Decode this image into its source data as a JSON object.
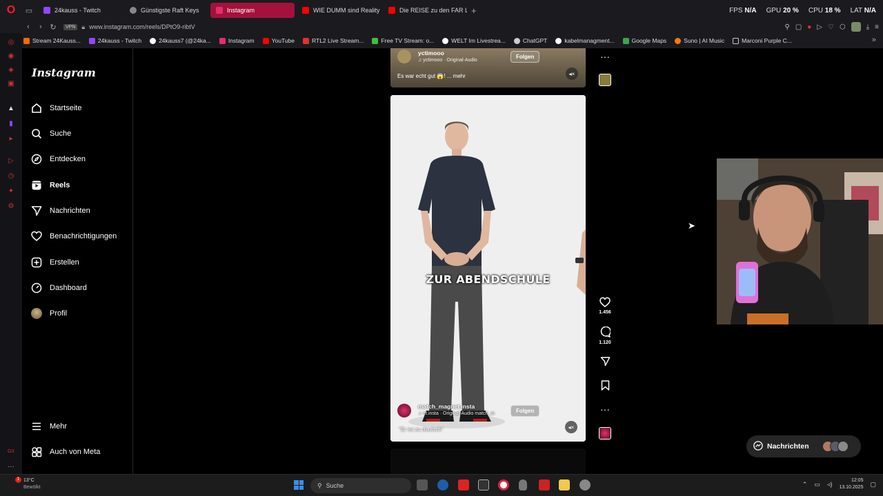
{
  "browser": {
    "tabs": [
      {
        "label": "24kauss - Twitch",
        "icon": "twitch-icon",
        "color": "#9146ff"
      },
      {
        "label": "Günstigste Raft Keys",
        "icon": "globe-icon",
        "color": "#888888"
      },
      {
        "label": "Instagram",
        "icon": "instagram-icon",
        "color": "#e1306c",
        "active": true
      },
      {
        "label": "WIE DUMM sind Reality S",
        "icon": "youtube-icon",
        "color": "#ff0000"
      },
      {
        "label": "Die REISE zu den FAR LA",
        "icon": "youtube-icon",
        "color": "#ff0000"
      }
    ],
    "stats": {
      "fps_label": "FPS",
      "fps_value": "N/A",
      "gpu_label": "GPU",
      "gpu_value": "20 %",
      "cpu_label": "CPU",
      "cpu_value": "18 %",
      "lat_label": "LAT",
      "lat_value": "N/A"
    },
    "vpn_label": "VPN",
    "url": "www.instagram.com/reels/DPtO9-ribtV",
    "bookmarks": [
      {
        "label": "Stream 24Kauss...",
        "color": "#ff6a00"
      },
      {
        "label": "24kauss - Twitch",
        "color": "#9146ff"
      },
      {
        "label": "24kauss7 (@24ka...",
        "color": "#ffffff"
      },
      {
        "label": "Instagram",
        "color": "#e1306c"
      },
      {
        "label": "YouTube",
        "color": "#ff0000"
      },
      {
        "label": "RTL2 Live Stream...",
        "color": "#e5312b"
      },
      {
        "label": "Free TV Stream: o...",
        "color": "#3fbf3f"
      },
      {
        "label": "WELT Im Livestrea...",
        "color": "#ffffff"
      },
      {
        "label": "ChatGPT",
        "color": "#cccccc"
      },
      {
        "label": "kabelmanagment...",
        "color": "#ffffff"
      },
      {
        "label": "Google Maps",
        "color": "#34a853"
      },
      {
        "label": "Suno | AI Music",
        "color": "#ff7a00"
      },
      {
        "label": "Marconi Purple C...",
        "color": "#cccccc"
      }
    ]
  },
  "instagram": {
    "logo": "Instagram",
    "nav": [
      {
        "label": "Startseite",
        "icon": "home-icon"
      },
      {
        "label": "Suche",
        "icon": "search-icon"
      },
      {
        "label": "Entdecken",
        "icon": "compass-icon"
      },
      {
        "label": "Reels",
        "icon": "reels-icon",
        "active": true
      },
      {
        "label": "Nachrichten",
        "icon": "send-icon"
      },
      {
        "label": "Benachrichtigungen",
        "icon": "heart-icon"
      },
      {
        "label": "Erstellen",
        "icon": "plus-square-icon"
      },
      {
        "label": "Dashboard",
        "icon": "dashboard-icon"
      },
      {
        "label": "Profil",
        "icon": "profile-avatar"
      }
    ],
    "nav_bottom": [
      {
        "label": "Mehr",
        "icon": "menu-icon"
      },
      {
        "label": "Auch von Meta",
        "icon": "meta-icon"
      }
    ],
    "reel_top": {
      "username": "yctimooo",
      "audio": "yctimooo · Original-Audio",
      "follow": "Folgen",
      "caption": "Es war echt gut 😱! ... mehr"
    },
    "reel_main": {
      "subtitle": "ZUR ABENDSCHULE",
      "username": "match_magnet.insta",
      "audio": "et.insta · Original-Audio   match_m",
      "follow": "Folgen",
      "caption": "\"Er ist zu deutsch\"",
      "likes": "1.456",
      "comments": "1.120"
    },
    "messages_pill": "Nachrichten"
  },
  "taskbar": {
    "weather_temp": "13°C",
    "weather_desc": "Bewölkt",
    "search_placeholder": "Suche",
    "time": "12:05",
    "date": "13.10.2025",
    "notif_badge": "1"
  }
}
